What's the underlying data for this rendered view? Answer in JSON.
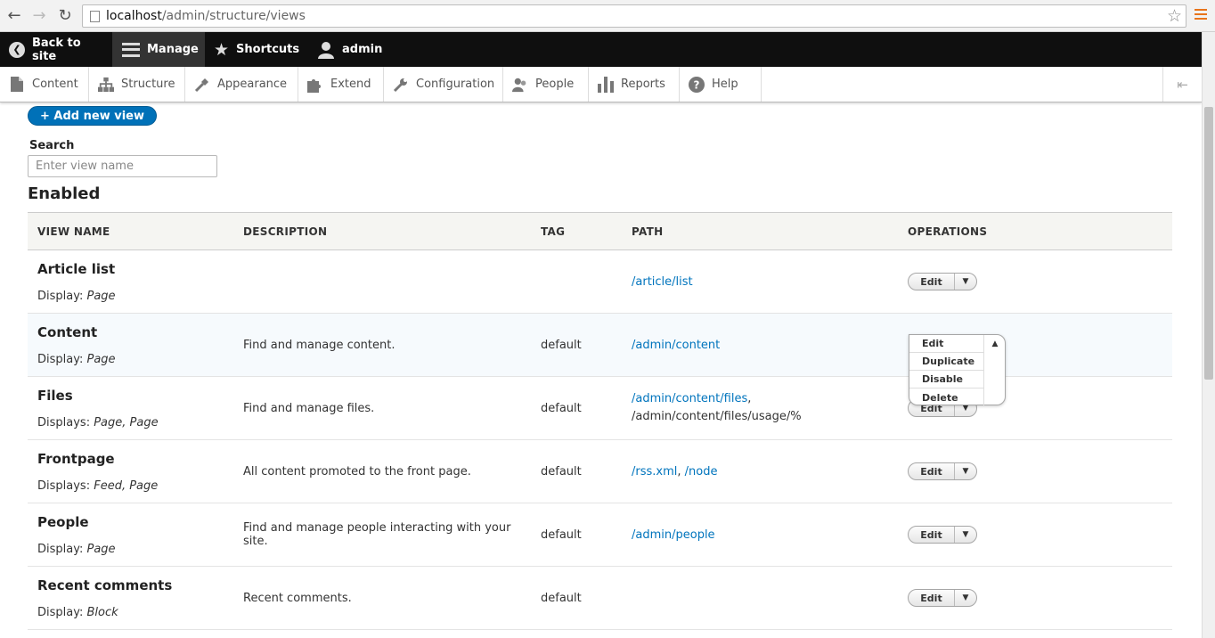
{
  "browser": {
    "url_host": "localhost",
    "url_path": "/admin/structure/views"
  },
  "toolbar": {
    "back_label": "Back to site",
    "manage_label": "Manage",
    "shortcuts_label": "Shortcuts",
    "user_label": "admin"
  },
  "tray": {
    "items": [
      {
        "label": "Content",
        "icon": "file-icon"
      },
      {
        "label": "Structure",
        "icon": "sitemap-icon"
      },
      {
        "label": "Appearance",
        "icon": "paintbrush-icon"
      },
      {
        "label": "Extend",
        "icon": "puzzle-icon"
      },
      {
        "label": "Configuration",
        "icon": "wrench-icon"
      },
      {
        "label": "People",
        "icon": "people-icon"
      },
      {
        "label": "Reports",
        "icon": "bar-chart-icon"
      },
      {
        "label": "Help",
        "icon": "help-icon"
      }
    ]
  },
  "page": {
    "add_view_label": "+ Add new view",
    "search_label": "Search",
    "search_placeholder": "Enter view name",
    "section_title": "Enabled"
  },
  "table": {
    "headers": [
      "View name",
      "Description",
      "Tag",
      "Path",
      "Operations"
    ],
    "rows": [
      {
        "name": "Article list",
        "display_prefix": "Display:",
        "display": "Page",
        "description": "",
        "tag": "",
        "paths": [
          {
            "text": "/article/list",
            "link": true
          }
        ]
      },
      {
        "name": "Content",
        "display_prefix": "Display:",
        "display": "Page",
        "description": "Find and manage content.",
        "tag": "default",
        "paths": [
          {
            "text": "/admin/content",
            "link": true
          }
        ]
      },
      {
        "name": "Files",
        "display_prefix": "Displays:",
        "display": "Page, Page",
        "description": "Find and manage files.",
        "tag": "default",
        "paths": [
          {
            "text": "/admin/content/files",
            "link": true,
            "suffix": ","
          },
          {
            "text": "/admin/content/files/usage/%",
            "link": false
          }
        ]
      },
      {
        "name": "Frontpage",
        "display_prefix": "Displays:",
        "display": "Feed, Page",
        "description": "All content promoted to the front page.",
        "tag": "default",
        "paths": [
          {
            "text": "/rss.xml",
            "link": true,
            "suffix": ", "
          },
          {
            "text": "/node",
            "link": true
          }
        ]
      },
      {
        "name": "People",
        "display_prefix": "Display:",
        "display": "Page",
        "description": "Find and manage people interacting with your site.",
        "tag": "default",
        "paths": [
          {
            "text": "/admin/people",
            "link": true
          }
        ]
      },
      {
        "name": "Recent comments",
        "display_prefix": "Display:",
        "display": "Block",
        "description": "Recent comments.",
        "tag": "default",
        "paths": []
      }
    ],
    "edit_label": "Edit"
  },
  "dropmenu": {
    "items": [
      "Edit",
      "Duplicate",
      "Disable",
      "Delete"
    ]
  },
  "colors": {
    "link": "#0074bd",
    "primary_button": "#0071b8",
    "toolbar_bg": "#0f0f0f"
  }
}
